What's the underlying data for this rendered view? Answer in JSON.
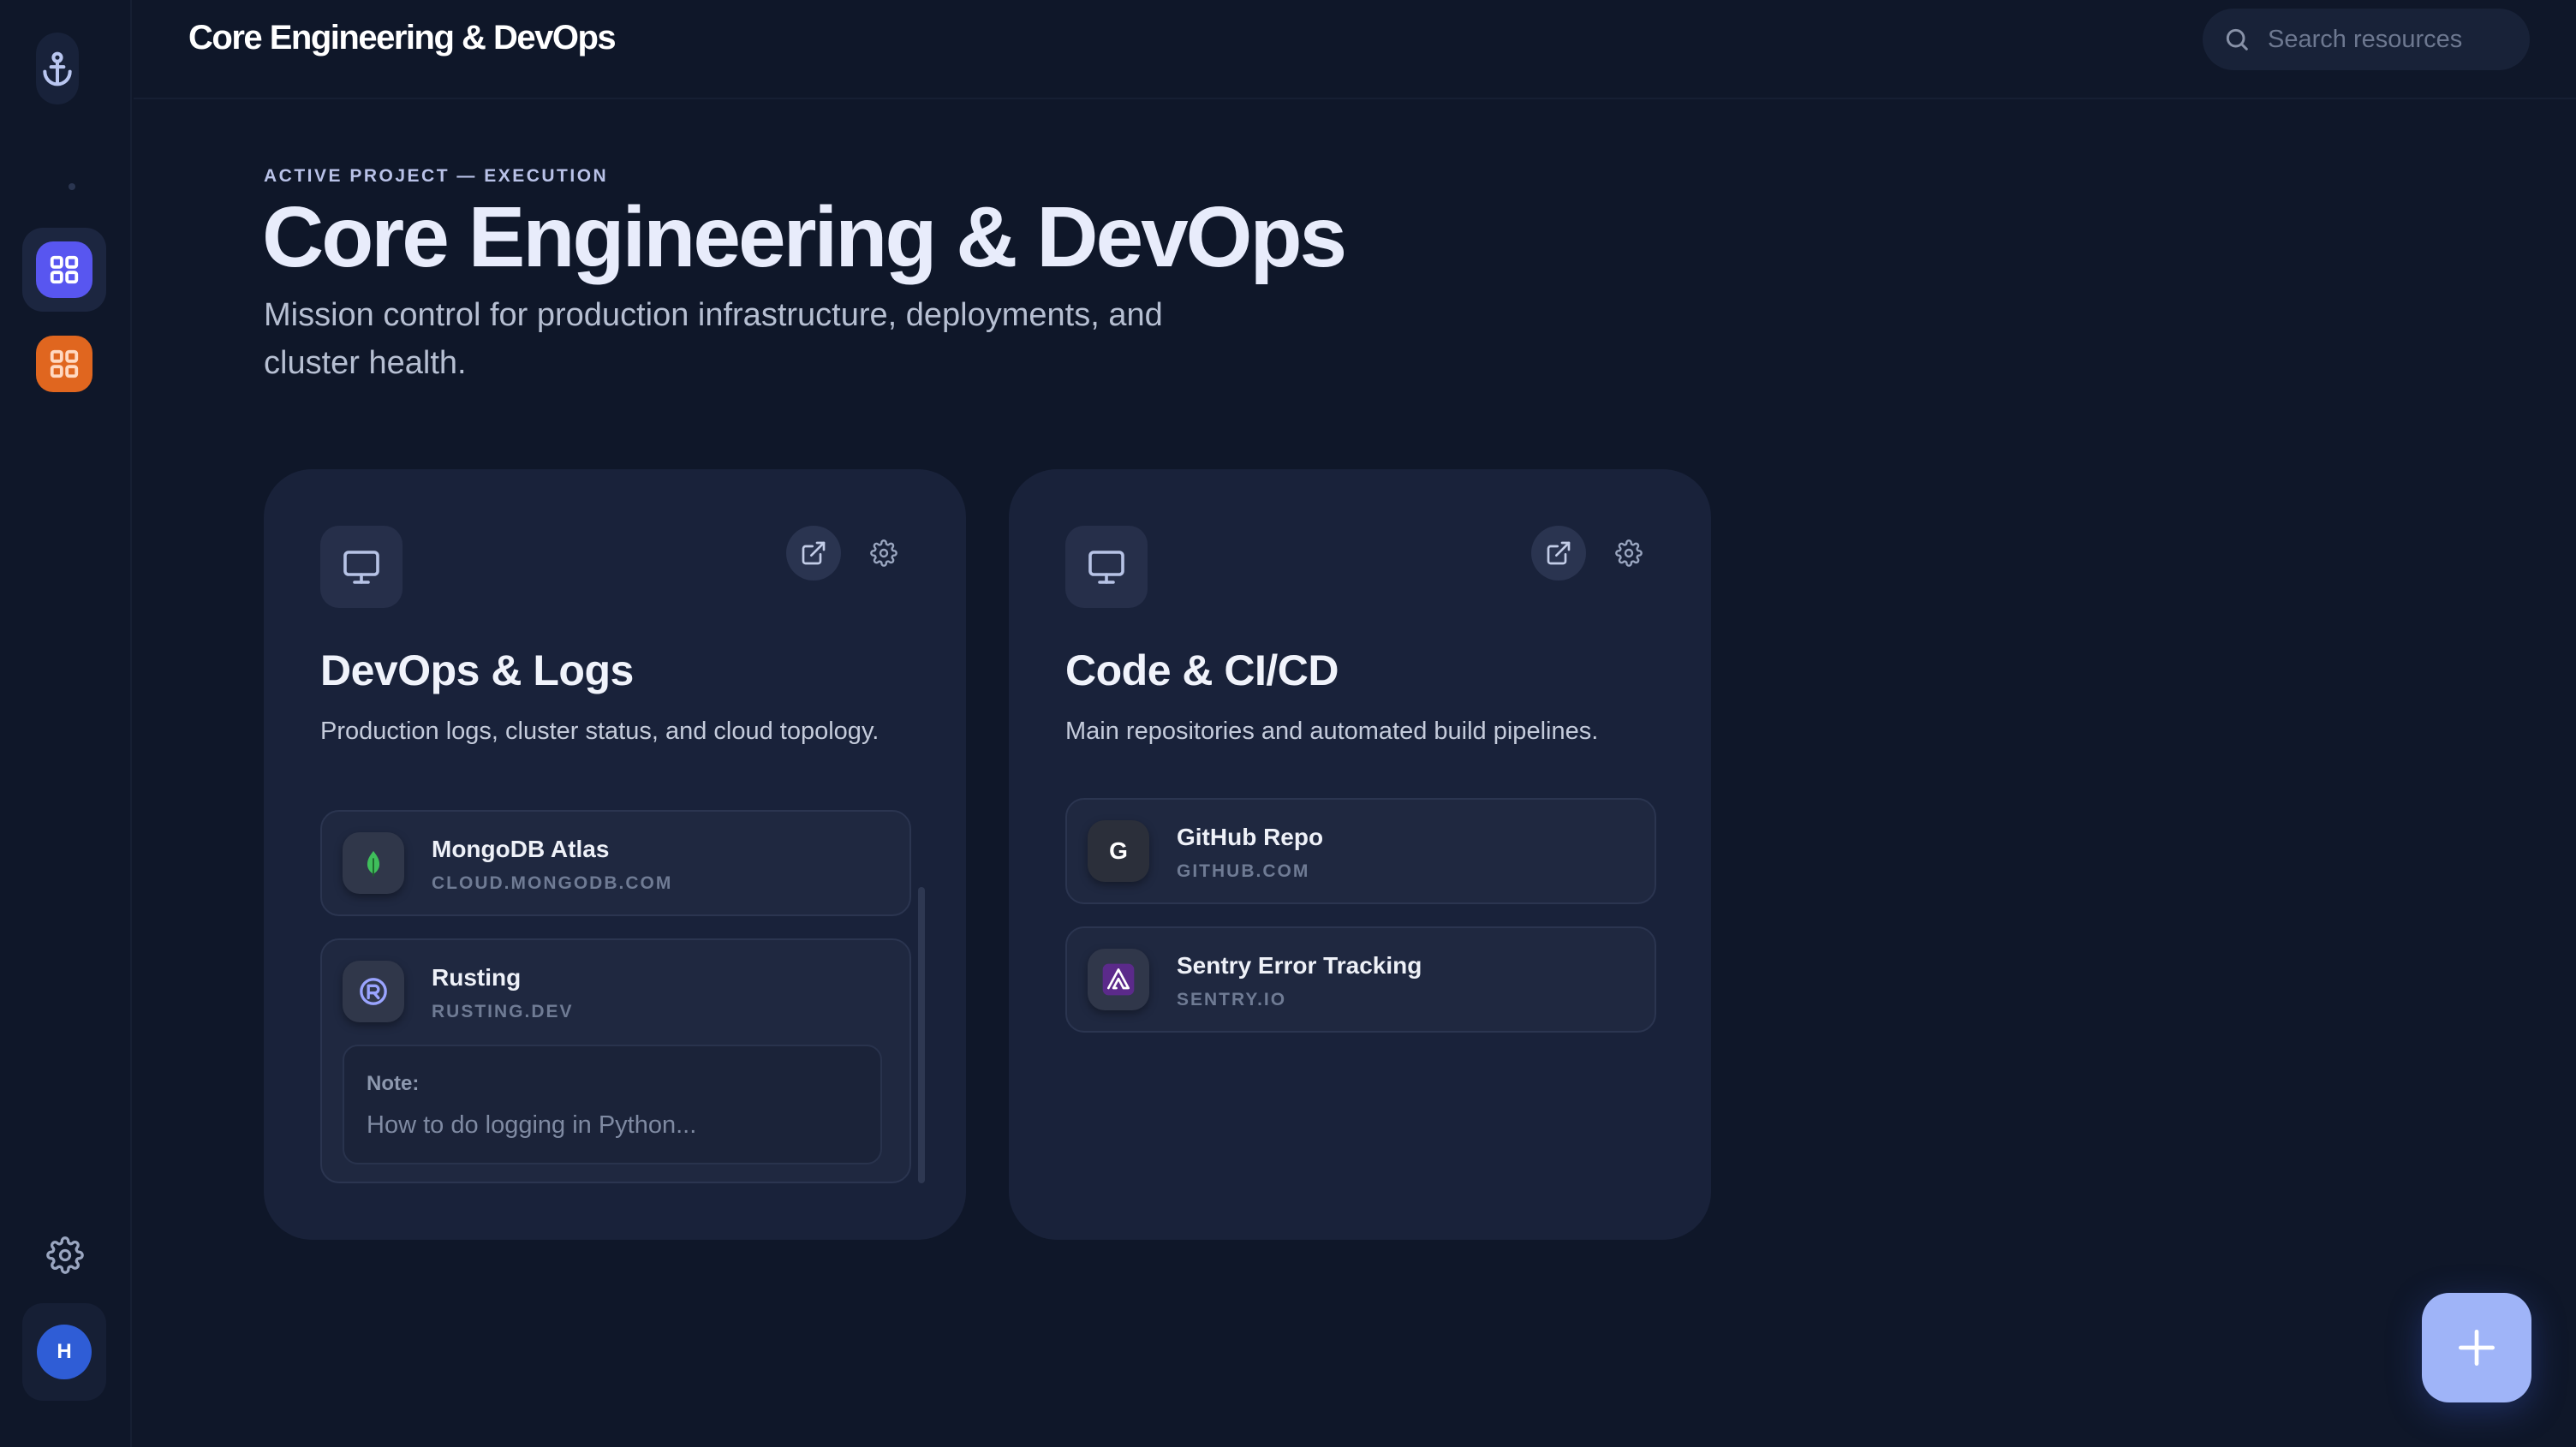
{
  "sidebar": {
    "logo_icon": "anchor-icon",
    "apps": [
      {
        "name": "app-indigo",
        "icon": "grid-icon",
        "color": "#5856f0",
        "active": true
      },
      {
        "name": "app-orange",
        "icon": "grid-icon",
        "color": "#e0661f",
        "active": false
      }
    ],
    "settings_icon": "gear-icon",
    "avatar_initial": "H"
  },
  "topbar": {
    "title": "Core Engineering & DevOps",
    "search_placeholder": "Search resources"
  },
  "hero": {
    "eyebrow": "ACTIVE PROJECT — EXECUTION",
    "title": "Core Engineering & DevOps",
    "subtitle": "Mission control for production infrastructure, deployments, and cluster health."
  },
  "cards": [
    {
      "icon": "monitor-icon",
      "title": "DevOps & Logs",
      "description": "Production logs, cluster status, and cloud topology.",
      "resources": [
        {
          "name": "MongoDB Atlas",
          "url": "CLOUD.MONGODB.COM",
          "icon": "mongodb-leaf-icon"
        },
        {
          "name": "Rusting",
          "url": "RUSTING.DEV",
          "icon": "rust-icon",
          "note_label": "Note:",
          "note_text": "How to do logging in Python..."
        }
      ]
    },
    {
      "icon": "monitor-icon",
      "title": "Code & CI/CD",
      "description": "Main repositories and automated build pipelines.",
      "resources": [
        {
          "name": "GitHub Repo",
          "url": "GITHUB.COM",
          "icon": "github-g-icon",
          "glyph": "G"
        },
        {
          "name": "Sentry Error Tracking",
          "url": "SENTRY.IO",
          "icon": "sentry-icon"
        }
      ]
    }
  ],
  "fab": {
    "icon": "plus-icon"
  },
  "colors": {
    "background": "#0f1729",
    "card": "#19223a",
    "accent": "#5856f0",
    "fab": "#9fb4f8"
  }
}
